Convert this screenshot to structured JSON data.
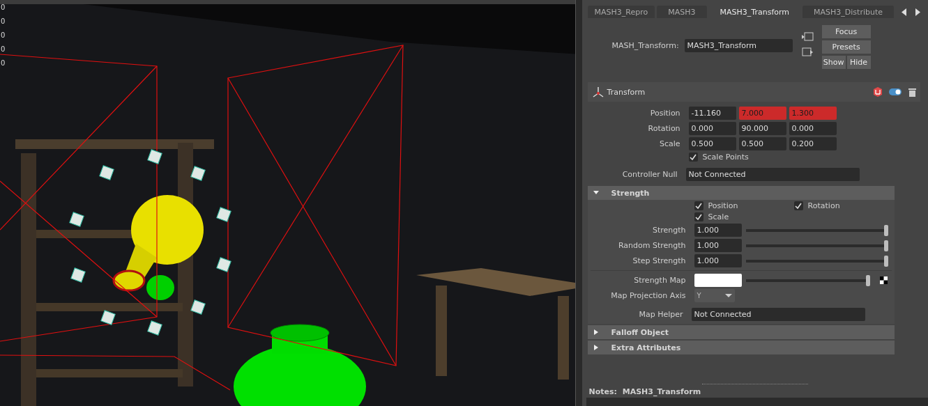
{
  "viewport": {
    "edge_labels": [
      "0",
      "0",
      "0",
      "0",
      "0"
    ]
  },
  "attribute_editor": {
    "tabs": [
      {
        "label": "MASH3_Repro",
        "selected": false
      },
      {
        "label": "MASH3",
        "selected": false
      },
      {
        "label": "MASH3_Transform",
        "selected": true
      },
      {
        "label": "MASH3_Distribute",
        "selected": false
      }
    ],
    "node_label": "MASH_Transform:",
    "node_name": "MASH3_Transform",
    "buttons": [
      "Focus",
      "Presets"
    ],
    "show_button": "Show",
    "hide_button": "Hide",
    "transform": {
      "title": "Transform",
      "enabled": true,
      "rows": [
        {
          "label": "Position",
          "values": [
            {
              "text": "-11.160",
              "keyed": false
            },
            {
              "text": "7.000",
              "keyed": true
            },
            {
              "text": "1.300",
              "keyed": true
            }
          ]
        },
        {
          "label": "Rotation",
          "values": [
            {
              "text": "0.000",
              "keyed": false
            },
            {
              "text": "90.000",
              "keyed": false
            },
            {
              "text": "0.000",
              "keyed": false
            }
          ]
        },
        {
          "label": "Scale",
          "values": [
            {
              "text": "0.500",
              "keyed": false
            },
            {
              "text": "0.500",
              "keyed": false
            },
            {
              "text": "0.200",
              "keyed": false
            }
          ]
        }
      ],
      "scale_points": {
        "label": "Scale Points",
        "checked": true
      },
      "controller_null": {
        "label": "Controller Null",
        "value": "Not Connected"
      }
    },
    "sections": [
      {
        "title": "Strength",
        "expanded": true
      },
      {
        "title": "Falloff Object",
        "expanded": false
      },
      {
        "title": "Extra Attributes",
        "expanded": false
      }
    ],
    "strength": {
      "checkboxes": [
        {
          "label": "Position",
          "checked": true
        },
        {
          "label": "Rotation",
          "checked": true
        },
        {
          "label": "Scale",
          "checked": true
        }
      ],
      "sliders": [
        {
          "label": "Strength",
          "value": "1.000",
          "level": 1
        },
        {
          "label": "Random Strength",
          "value": "1.000",
          "level": 1
        },
        {
          "label": "Step Strength",
          "value": "1.000",
          "level": 1
        }
      ],
      "strength_map": {
        "label": "Strength Map",
        "level": 1
      },
      "map_projection_axis": {
        "label": "Map Projection Axis",
        "value": "Y"
      },
      "map_helper": {
        "label": "Map Helper",
        "value": "Not Connected"
      }
    },
    "notes": {
      "label": "Notes:",
      "value": "MASH3_Transform"
    }
  }
}
